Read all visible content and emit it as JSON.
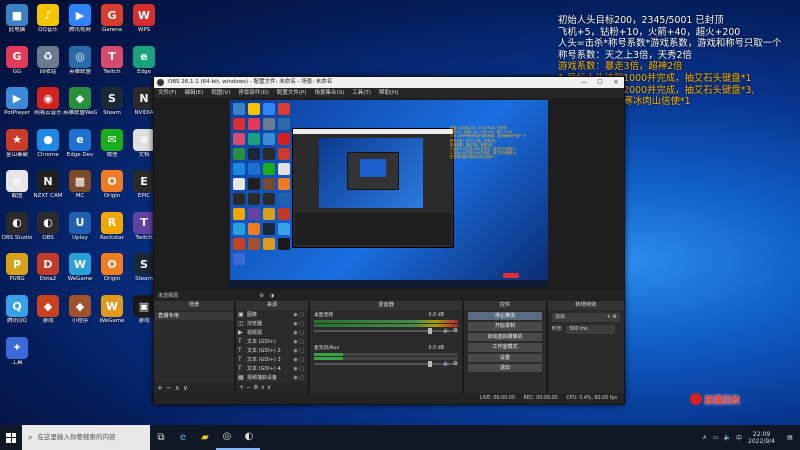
{
  "desktop_icons": [
    {
      "label": "此电脑",
      "color": "#3b82c4",
      "glyph": "■"
    },
    {
      "label": "QQ音乐",
      "color": "#f5c400",
      "glyph": "♪"
    },
    {
      "label": "腾讯视频",
      "color": "#2f84ff",
      "glyph": "▶"
    },
    {
      "label": "Garena",
      "color": "#d73c2c",
      "glyph": "G"
    },
    {
      "label": "WPS",
      "color": "#d92e2e",
      "glyph": "W"
    },
    {
      "label": "GG",
      "color": "#e23b5a",
      "glyph": "G"
    },
    {
      "label": "回收站",
      "color": "#6b7a90",
      "glyph": "♻"
    },
    {
      "label": "英雄联盟",
      "color": "#2a6aa8",
      "glyph": "◎"
    },
    {
      "label": "Twitch",
      "color": "#d94b6a",
      "glyph": "T"
    },
    {
      "label": "Edge",
      "color": "#1aa37a",
      "glyph": "e"
    },
    {
      "label": "PotPlayer",
      "color": "#3a8ad8",
      "glyph": "▶"
    },
    {
      "label": "网易云音乐",
      "color": "#d61f1f",
      "glyph": "◉"
    },
    {
      "label": "英雄联盟WeGame",
      "color": "#2a8f3a",
      "glyph": "◆"
    },
    {
      "label": "Steam",
      "color": "#1b2838",
      "glyph": "S"
    },
    {
      "label": "NVIDIA",
      "color": "#2a2a2a",
      "glyph": "N"
    },
    {
      "label": "金山毒霸",
      "color": "#cc3a2a",
      "glyph": "★"
    },
    {
      "label": "Chrome",
      "color": "#1e88e5",
      "glyph": "●"
    },
    {
      "label": "Edge Dev",
      "color": "#1d6fd0",
      "glyph": "e"
    },
    {
      "label": "微信",
      "color": "#1aad19",
      "glyph": "✉"
    },
    {
      "label": "文档",
      "color": "#e0e0e0",
      "glyph": "≡"
    },
    {
      "label": "截图",
      "color": "#e6e6e6",
      "glyph": "≡"
    },
    {
      "label": "NZXT CAM",
      "color": "#1f1f1f",
      "glyph": "N"
    },
    {
      "label": "MC",
      "color": "#7a4a2a",
      "glyph": "▩"
    },
    {
      "label": "Origin",
      "color": "#ef7b22",
      "glyph": "O"
    },
    {
      "label": "EPIC",
      "color": "#2a2a2a",
      "glyph": "E"
    },
    {
      "label": "OBS Studio",
      "color": "#2b2b2b",
      "glyph": "◐"
    },
    {
      "label": "OBS",
      "color": "#2b2b2b",
      "glyph": "◐"
    },
    {
      "label": "Uplay",
      "color": "#1e5fb0",
      "glyph": "U"
    },
    {
      "label": "Rockstar",
      "color": "#f2a600",
      "glyph": "R"
    },
    {
      "label": "Twitch",
      "color": "#6441a5",
      "glyph": "T"
    },
    {
      "label": "PUBG",
      "color": "#d6a21a",
      "glyph": "P"
    },
    {
      "label": "Dota2",
      "color": "#c23a2a",
      "glyph": "D"
    },
    {
      "label": "WeGame",
      "color": "#2aa0d8",
      "glyph": "W"
    },
    {
      "label": "Origin",
      "color": "#f07d1e",
      "glyph": "O"
    },
    {
      "label": "Steam",
      "color": "#1b2838",
      "glyph": "S"
    },
    {
      "label": "腾讯QQ",
      "color": "#3aa0e8",
      "glyph": "Q"
    },
    {
      "label": "游戏",
      "color": "#c8401e",
      "glyph": "◆"
    },
    {
      "label": "小程序",
      "color": "#a0522d",
      "glyph": "◆"
    },
    {
      "label": "WeGame",
      "color": "#e09a1a",
      "glyph": "W"
    },
    {
      "label": "游戏",
      "color": "#1a1a1a",
      "glyph": "▣"
    },
    {
      "label": "工具",
      "color": "#3a6ad8",
      "glyph": "✦"
    }
  ],
  "overlay": {
    "lines": [
      {
        "text": "初始人头目标200，2345/5001 已封顶",
        "color": "white"
      },
      {
        "text": "飞机+5，钻粉+10，火箭+40，超火+200",
        "color": "white"
      },
      {
        "text": "人头=击杀*称号系数*游戏系数，游戏和称号只取一个",
        "color": "white"
      },
      {
        "text": "称号系数：天之上3倍，天秀2倍",
        "color": "white"
      },
      {
        "text": "游戏系数：暴走3倍，超神2倍",
        "color": "white"
      },
      {
        "text": "1.目标人头达到1000并完成，抽艾石头键盘*1",
        "color": "yellow"
      },
      {
        "text": "2.目标人头达到2000并完成，抽艾石头键盘*3,",
        "color": "yellow"
      },
      {
        "text": "先完成的额外抽寒冰肉山信使*1",
        "color": "yellow"
      }
    ]
  },
  "obs": {
    "title": "OBS 26.1.1 (64-bit, windows) - 配置文件: 未命名 - 场景: 未命名",
    "menu": [
      "文件(F)",
      "编辑(E)",
      "视图(V)",
      "停靠部件(D)",
      "配置文件(P)",
      "场景集合(S)",
      "工具(T)",
      "帮助(H)"
    ],
    "dock_bar_label": "未选择源",
    "scenes": {
      "header": "场景",
      "items": [
        "直播专用"
      ]
    },
    "sources": {
      "header": "来源",
      "items": [
        {
          "label": "图像",
          "icon": "▣"
        },
        {
          "label": "浏览器",
          "icon": "◫"
        },
        {
          "label": "视频源",
          "icon": "▶"
        },
        {
          "label": "文本 (GDI+)",
          "icon": "T"
        },
        {
          "label": "文本 (GDI+) 2",
          "icon": "T"
        },
        {
          "label": "文本 (GDI+) 3",
          "icon": "T"
        },
        {
          "label": "文本 (GDI+) 4",
          "icon": "T"
        },
        {
          "label": "视频捕获设备",
          "icon": "▦"
        },
        {
          "label": "显示器采集",
          "icon": "▭"
        }
      ]
    },
    "mixer": {
      "header": "混音器",
      "channels": [
        {
          "name": "桌面音频",
          "value": "0.0 dB"
        },
        {
          "name": "麦克风/Aux",
          "value": "0.0 dB"
        }
      ]
    },
    "controls": {
      "header": "控件",
      "buttons": [
        "停止推流",
        "开始录制",
        "启动虚拟摄像机",
        "工作室模式",
        "设置",
        "退出"
      ]
    },
    "transitions": {
      "header": "转场特效",
      "selected": "淡出",
      "duration_label": "时长",
      "duration_value": "300 ms"
    },
    "status": {
      "live": "LIVE: 00:00:00",
      "rec": "REC: 00:00:00",
      "cpu": "CPU: 0.4%, 60.00 fps"
    }
  },
  "watermark": {
    "text": "直播回放"
  },
  "taskbar": {
    "search_placeholder": "在这里输入你要搜索的内容",
    "clock_time": "22:09",
    "clock_date": "2022/9/4"
  }
}
